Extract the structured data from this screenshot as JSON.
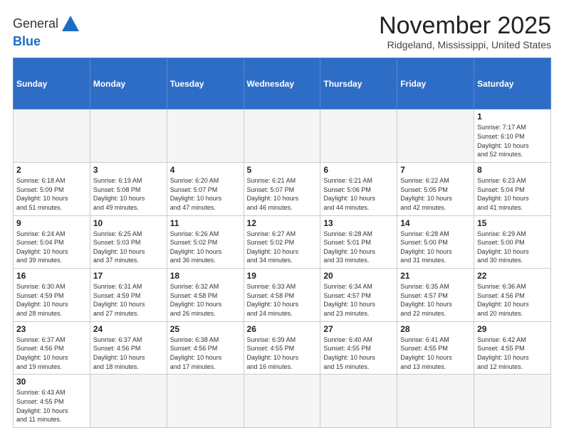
{
  "logo": {
    "line1": "General",
    "line2": "Blue"
  },
  "title": "November 2025",
  "location": "Ridgeland, Mississippi, United States",
  "weekdays": [
    "Sunday",
    "Monday",
    "Tuesday",
    "Wednesday",
    "Thursday",
    "Friday",
    "Saturday"
  ],
  "weeks": [
    [
      {
        "day": null,
        "info": ""
      },
      {
        "day": null,
        "info": ""
      },
      {
        "day": null,
        "info": ""
      },
      {
        "day": null,
        "info": ""
      },
      {
        "day": null,
        "info": ""
      },
      {
        "day": null,
        "info": ""
      },
      {
        "day": "1",
        "info": "Sunrise: 7:17 AM\nSunset: 6:10 PM\nDaylight: 10 hours\nand 52 minutes."
      }
    ],
    [
      {
        "day": "2",
        "info": "Sunrise: 6:18 AM\nSunset: 5:09 PM\nDaylight: 10 hours\nand 51 minutes."
      },
      {
        "day": "3",
        "info": "Sunrise: 6:19 AM\nSunset: 5:08 PM\nDaylight: 10 hours\nand 49 minutes."
      },
      {
        "day": "4",
        "info": "Sunrise: 6:20 AM\nSunset: 5:07 PM\nDaylight: 10 hours\nand 47 minutes."
      },
      {
        "day": "5",
        "info": "Sunrise: 6:21 AM\nSunset: 5:07 PM\nDaylight: 10 hours\nand 46 minutes."
      },
      {
        "day": "6",
        "info": "Sunrise: 6:21 AM\nSunset: 5:06 PM\nDaylight: 10 hours\nand 44 minutes."
      },
      {
        "day": "7",
        "info": "Sunrise: 6:22 AM\nSunset: 5:05 PM\nDaylight: 10 hours\nand 42 minutes."
      },
      {
        "day": "8",
        "info": "Sunrise: 6:23 AM\nSunset: 5:04 PM\nDaylight: 10 hours\nand 41 minutes."
      }
    ],
    [
      {
        "day": "9",
        "info": "Sunrise: 6:24 AM\nSunset: 5:04 PM\nDaylight: 10 hours\nand 39 minutes."
      },
      {
        "day": "10",
        "info": "Sunrise: 6:25 AM\nSunset: 5:03 PM\nDaylight: 10 hours\nand 37 minutes."
      },
      {
        "day": "11",
        "info": "Sunrise: 6:26 AM\nSunset: 5:02 PM\nDaylight: 10 hours\nand 36 minutes."
      },
      {
        "day": "12",
        "info": "Sunrise: 6:27 AM\nSunset: 5:02 PM\nDaylight: 10 hours\nand 34 minutes."
      },
      {
        "day": "13",
        "info": "Sunrise: 6:28 AM\nSunset: 5:01 PM\nDaylight: 10 hours\nand 33 minutes."
      },
      {
        "day": "14",
        "info": "Sunrise: 6:28 AM\nSunset: 5:00 PM\nDaylight: 10 hours\nand 31 minutes."
      },
      {
        "day": "15",
        "info": "Sunrise: 6:29 AM\nSunset: 5:00 PM\nDaylight: 10 hours\nand 30 minutes."
      }
    ],
    [
      {
        "day": "16",
        "info": "Sunrise: 6:30 AM\nSunset: 4:59 PM\nDaylight: 10 hours\nand 28 minutes."
      },
      {
        "day": "17",
        "info": "Sunrise: 6:31 AM\nSunset: 4:59 PM\nDaylight: 10 hours\nand 27 minutes."
      },
      {
        "day": "18",
        "info": "Sunrise: 6:32 AM\nSunset: 4:58 PM\nDaylight: 10 hours\nand 26 minutes."
      },
      {
        "day": "19",
        "info": "Sunrise: 6:33 AM\nSunset: 4:58 PM\nDaylight: 10 hours\nand 24 minutes."
      },
      {
        "day": "20",
        "info": "Sunrise: 6:34 AM\nSunset: 4:57 PM\nDaylight: 10 hours\nand 23 minutes."
      },
      {
        "day": "21",
        "info": "Sunrise: 6:35 AM\nSunset: 4:57 PM\nDaylight: 10 hours\nand 22 minutes."
      },
      {
        "day": "22",
        "info": "Sunrise: 6:36 AM\nSunset: 4:56 PM\nDaylight: 10 hours\nand 20 minutes."
      }
    ],
    [
      {
        "day": "23",
        "info": "Sunrise: 6:37 AM\nSunset: 4:56 PM\nDaylight: 10 hours\nand 19 minutes."
      },
      {
        "day": "24",
        "info": "Sunrise: 6:37 AM\nSunset: 4:56 PM\nDaylight: 10 hours\nand 18 minutes."
      },
      {
        "day": "25",
        "info": "Sunrise: 6:38 AM\nSunset: 4:56 PM\nDaylight: 10 hours\nand 17 minutes."
      },
      {
        "day": "26",
        "info": "Sunrise: 6:39 AM\nSunset: 4:55 PM\nDaylight: 10 hours\nand 16 minutes."
      },
      {
        "day": "27",
        "info": "Sunrise: 6:40 AM\nSunset: 4:55 PM\nDaylight: 10 hours\nand 15 minutes."
      },
      {
        "day": "28",
        "info": "Sunrise: 6:41 AM\nSunset: 4:55 PM\nDaylight: 10 hours\nand 13 minutes."
      },
      {
        "day": "29",
        "info": "Sunrise: 6:42 AM\nSunset: 4:55 PM\nDaylight: 10 hours\nand 12 minutes."
      }
    ],
    [
      {
        "day": "30",
        "info": "Sunrise: 6:43 AM\nSunset: 4:55 PM\nDaylight: 10 hours\nand 11 minutes."
      },
      {
        "day": null,
        "info": ""
      },
      {
        "day": null,
        "info": ""
      },
      {
        "day": null,
        "info": ""
      },
      {
        "day": null,
        "info": ""
      },
      {
        "day": null,
        "info": ""
      },
      {
        "day": null,
        "info": ""
      }
    ]
  ]
}
